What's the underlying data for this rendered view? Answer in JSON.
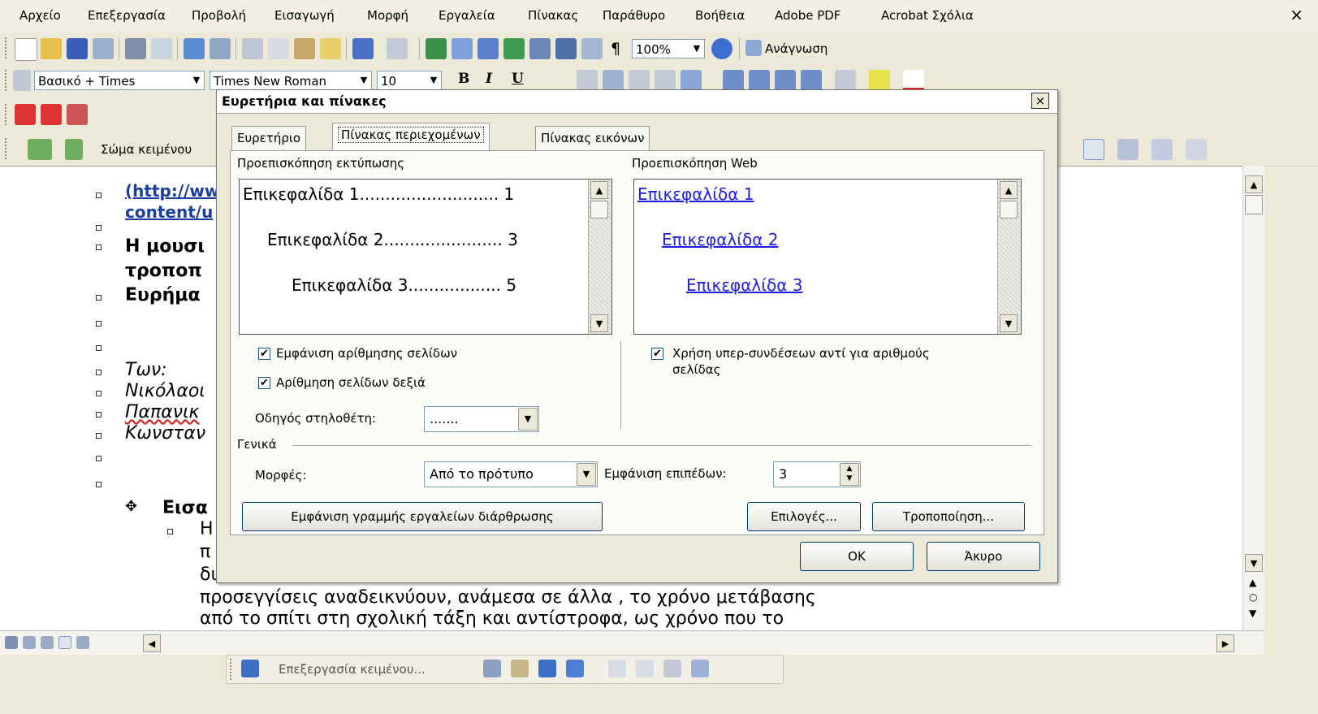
{
  "menu": {
    "items": [
      "Αρχείο",
      "Επεξεργασία",
      "Προβολή",
      "Εισαγωγή",
      "Μορφή",
      "Εργαλεία",
      "Πίνακας",
      "Παράθυρο",
      "Βοήθεια",
      "Adobe PDF",
      "Acrobat Σχόλια"
    ],
    "close": "×"
  },
  "standard_toolbar": {
    "zoom": "100%",
    "reading_label": "Ανάγνωση",
    "pilcrow": "¶"
  },
  "formatting_toolbar": {
    "style": "Βασικό + Times",
    "font": "Times New Roman",
    "size": "10",
    "bold": "B",
    "italic": "I",
    "underline": "U"
  },
  "outline_toolbar": {
    "level": "Σώμα κειμένου"
  },
  "document": {
    "lines": [
      "(http://ww",
      "content/u",
      "Η μουσι",
      "τροποπ",
      "Ευρήμα",
      "Των:",
      "Νικόλαοι",
      "Παπανικ",
      "Κωνσταν",
      "Εισα",
      "Η",
      "π",
      "δι",
      "προσεγγίσεις αναδεικνύουν, ανάμεσα σε άλλα , το χρόνο μετάβασης",
      "από το σπίτι στη σχολική τάξη και αντίστροφα, ως χρόνο που το"
    ]
  },
  "drawing_toolbar": {
    "edit_text": "Επεξεργασία κειμένου..."
  },
  "dialog": {
    "title": "Ευρετήρια και πίνακες",
    "close": "×",
    "tabs": [
      "Ευρετήριο",
      "Πίνακας περιεχομένων",
      "Πίνακας εικόνων"
    ],
    "print_preview_label": "Προεπισκόπηση εκτύπωσης",
    "print_preview_lines": [
      "Επικεφαλίδα 1........................... 1",
      "Επικεφαλίδα 2....................... 3",
      "Επικεφαλίδα 3.................. 5"
    ],
    "web_preview_label": "Προεπισκόπηση Web",
    "web_preview_links": [
      "Επικεφαλίδα 1",
      "Επικεφαλίδα 2",
      "Επικεφαλίδα 3"
    ],
    "show_page_numbers": "Εμφάνιση αρίθμησης σελίδων",
    "right_align": "Αρίθμηση σελίδων δεξιά",
    "tab_leader_label": "Οδηγός στηλοθέτη:",
    "tab_leader_value": ".......",
    "use_hyperlinks_line1": "Χρήση υπερ-συνδέσεων αντί για αριθμούς",
    "use_hyperlinks_line2": "σελίδας",
    "general_label": "Γενικά",
    "formats_label": "Μορφές:",
    "formats_value": "Από το πρότυπο",
    "show_levels_label": "Εμφάνιση επιπέδων:",
    "show_levels_value": "3",
    "outline_toolbar_button": "Εμφάνιση γραμμής εργαλείων διάρθρωσης",
    "options_button": "Επιλογές...",
    "modify_button": "Τροποποίηση...",
    "ok_button": "OK",
    "cancel_button": "Άκυρο",
    "checkmark": "✔"
  }
}
